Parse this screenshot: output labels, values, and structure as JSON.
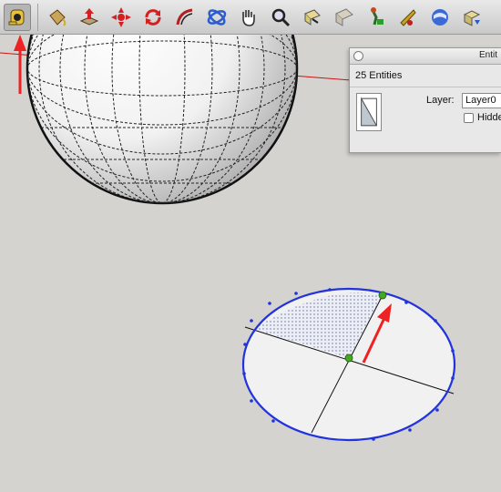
{
  "toolbar": {
    "tools": [
      {
        "icon": "tape-measure-icon",
        "selected": true
      },
      {
        "icon": "paint-bucket-icon"
      },
      {
        "icon": "push-pull-icon"
      },
      {
        "icon": "move-icon"
      },
      {
        "icon": "rotate-icon"
      },
      {
        "icon": "follow-me-icon"
      },
      {
        "icon": "orbit-icon"
      },
      {
        "icon": "pan-icon"
      },
      {
        "icon": "zoom-icon"
      },
      {
        "icon": "zoom-extents-icon"
      },
      {
        "icon": "previous-view-icon"
      },
      {
        "icon": "position-camera-icon"
      },
      {
        "icon": "walk-icon"
      },
      {
        "icon": "get-models-icon"
      },
      {
        "icon": "share-model-icon"
      }
    ]
  },
  "entity_info": {
    "title": "Entit",
    "count": "25 Entities",
    "layer_label": "Layer:",
    "layer_value": "Layer0",
    "hidden_label": "Hidde"
  },
  "colors": {
    "background": "#d4d3cf",
    "selection_blue": "#2233dd",
    "axis_red": "#cc1111",
    "endpoint_green": "#44aa22",
    "annotation_arrow": "#ee2222"
  }
}
